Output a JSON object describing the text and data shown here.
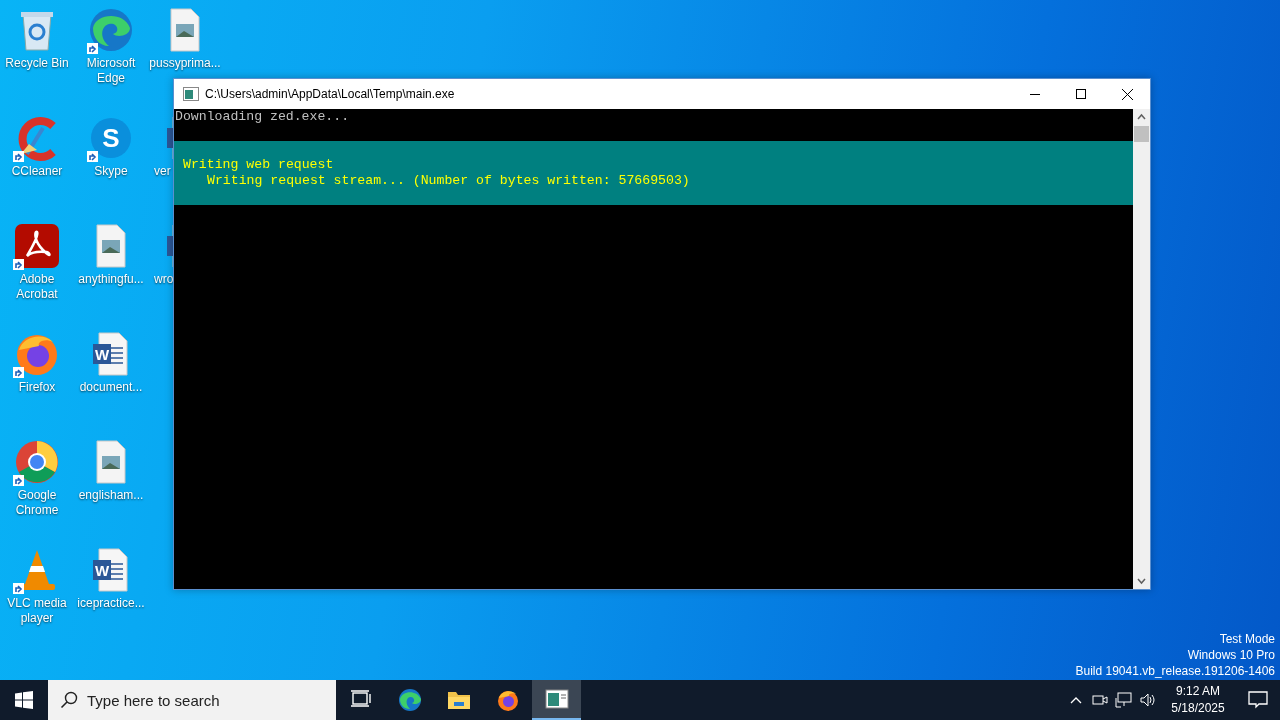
{
  "desktop_icons": [
    {
      "label": "Recycle Bin",
      "kind": "recycle",
      "shortcut": false,
      "covered": false
    },
    {
      "label": "CCleaner",
      "kind": "ccleaner",
      "shortcut": true,
      "covered": false
    },
    {
      "label": "Adobe Acrobat",
      "kind": "acrobat",
      "shortcut": true,
      "covered": false
    },
    {
      "label": "Firefox",
      "kind": "firefox",
      "shortcut": true,
      "covered": false
    },
    {
      "label": "Google Chrome",
      "kind": "chrome",
      "shortcut": true,
      "covered": false
    },
    {
      "label": "VLC media player",
      "kind": "vlc",
      "shortcut": true,
      "covered": false
    },
    {
      "label": "Microsoft Edge",
      "kind": "edge",
      "shortcut": true,
      "covered": false
    },
    {
      "label": "Skype",
      "kind": "skype",
      "glyph": "S",
      "shortcut": true,
      "covered": false
    },
    {
      "label": "anythingfu...",
      "kind": "image",
      "shortcut": false,
      "covered": false
    },
    {
      "label": "document...",
      "kind": "word",
      "glyph": "W",
      "shortcut": false,
      "covered": false
    },
    {
      "label": "englisham...",
      "kind": "image",
      "shortcut": false,
      "covered": false
    },
    {
      "label": "icepractice...",
      "kind": "word",
      "glyph": "W",
      "shortcut": false,
      "covered": false
    },
    {
      "label": "pussyprima...",
      "kind": "image",
      "shortcut": false,
      "covered": false
    },
    {
      "label": "ver",
      "kind": "word",
      "shortcut": false,
      "covered": true
    },
    {
      "label": "wro",
      "kind": "word",
      "shortcut": false,
      "covered": true
    }
  ],
  "console_window": {
    "title": "C:\\Users\\admin\\AppData\\Local\\Temp\\main.exe",
    "lines": [
      "Downloading zed.exe..."
    ],
    "highlight_block": {
      "heading": "Writing web request",
      "children": [
        "Writing request stream... (Number of bytes written: 57669503)"
      ]
    }
  },
  "taskbar": {
    "search": {
      "placeholder": "Type here to search"
    },
    "apps": [
      {
        "kind": "taskview",
        "active": false
      },
      {
        "kind": "edge",
        "active": false
      },
      {
        "kind": "folder",
        "active": false
      },
      {
        "kind": "firefox",
        "active": false
      },
      {
        "kind": "console",
        "active": true
      }
    ],
    "time": "9:12 AM",
    "date": "5/18/2025"
  },
  "system_text": [
    "Test Mode",
    "Windows 10 Pro",
    "Build 19041.vb_release.191206-1406"
  ]
}
